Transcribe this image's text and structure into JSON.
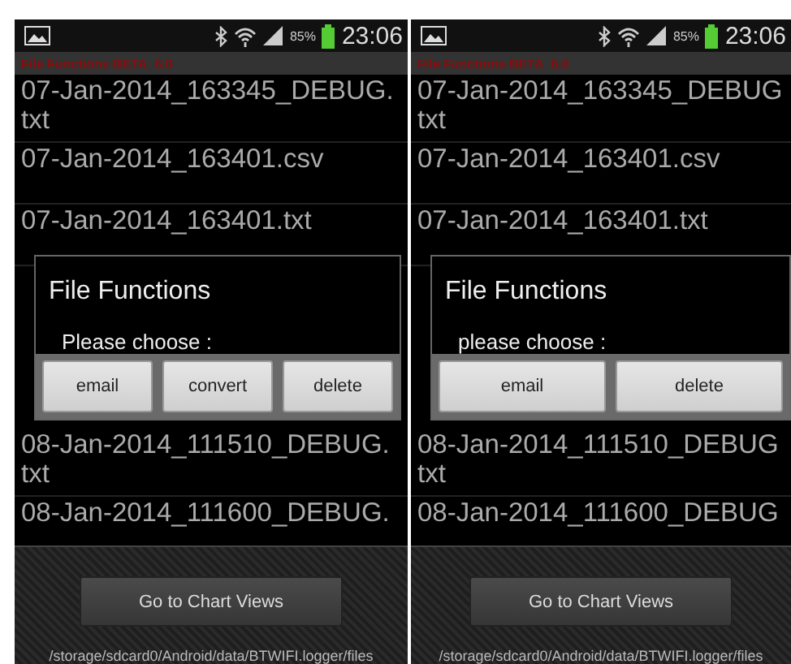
{
  "phones": [
    {
      "status_bar": {
        "battery_percent": "85%",
        "time": "23:06"
      },
      "app_title": "File Functions BETA_6.0",
      "files_above": [
        {
          "lines": [
            "07-Jan-2014_163345_DEBUG.",
            "txt"
          ]
        },
        {
          "lines": [
            "07-Jan-2014_163401.csv"
          ]
        },
        {
          "lines": [
            "07-Jan-2014_163401.txt"
          ]
        }
      ],
      "files_below": [
        {
          "lines": [
            "08-Jan-2014_111510_DEBUG.",
            "txt"
          ]
        },
        {
          "lines": [
            "08-Jan-2014_111600_DEBUG."
          ]
        }
      ],
      "dialog": {
        "title": "File Functions",
        "message": "Please choose :",
        "buttons": [
          "email",
          "convert",
          "delete"
        ]
      },
      "chart_button": "Go to Chart Views",
      "path": "/storage/sdcard0/Android/data/BTWIFI.logger/files"
    },
    {
      "status_bar": {
        "battery_percent": "85%",
        "time": "23:06"
      },
      "app_title": "File Functions BETA_6.0",
      "files_above": [
        {
          "lines": [
            "07-Jan-2014_163345_DEBUG",
            "txt"
          ]
        },
        {
          "lines": [
            "07-Jan-2014_163401.csv"
          ]
        },
        {
          "lines": [
            "07-Jan-2014_163401.txt"
          ]
        }
      ],
      "files_below": [
        {
          "lines": [
            "08-Jan-2014_111510_DEBUG",
            "txt"
          ]
        },
        {
          "lines": [
            "08-Jan-2014_111600_DEBUG"
          ]
        }
      ],
      "dialog": {
        "title": "File Functions",
        "message": "please choose :",
        "buttons": [
          "email",
          "delete"
        ]
      },
      "chart_button": "Go to Chart Views",
      "path": "/storage/sdcard0/Android/data/BTWIFI.logger/files"
    }
  ]
}
